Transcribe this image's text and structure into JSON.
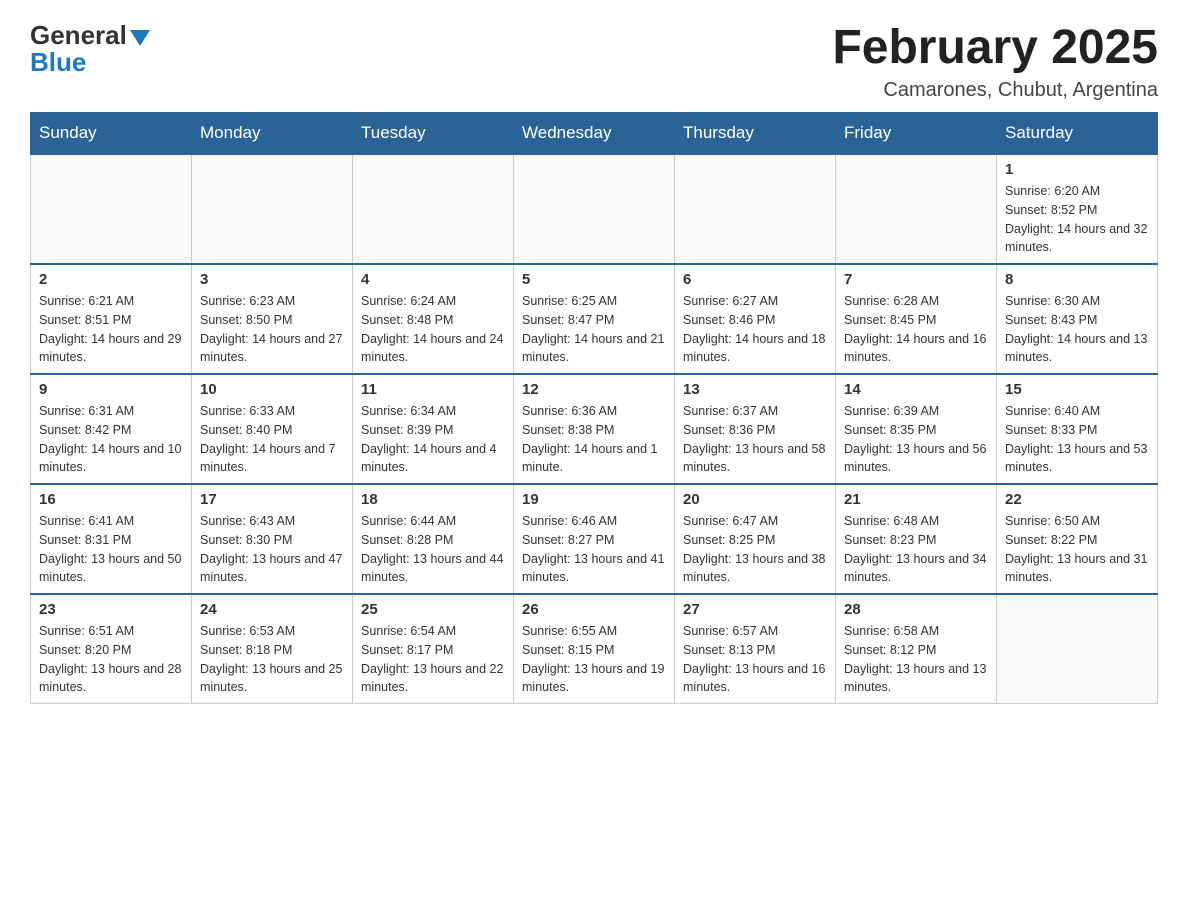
{
  "logo": {
    "text_general": "General",
    "text_blue": "Blue"
  },
  "header": {
    "month_title": "February 2025",
    "location": "Camarones, Chubut, Argentina"
  },
  "days_of_week": [
    "Sunday",
    "Monday",
    "Tuesday",
    "Wednesday",
    "Thursday",
    "Friday",
    "Saturday"
  ],
  "weeks": [
    [
      {
        "day": "",
        "info": ""
      },
      {
        "day": "",
        "info": ""
      },
      {
        "day": "",
        "info": ""
      },
      {
        "day": "",
        "info": ""
      },
      {
        "day": "",
        "info": ""
      },
      {
        "day": "",
        "info": ""
      },
      {
        "day": "1",
        "info": "Sunrise: 6:20 AM\nSunset: 8:52 PM\nDaylight: 14 hours and 32 minutes."
      }
    ],
    [
      {
        "day": "2",
        "info": "Sunrise: 6:21 AM\nSunset: 8:51 PM\nDaylight: 14 hours and 29 minutes."
      },
      {
        "day": "3",
        "info": "Sunrise: 6:23 AM\nSunset: 8:50 PM\nDaylight: 14 hours and 27 minutes."
      },
      {
        "day": "4",
        "info": "Sunrise: 6:24 AM\nSunset: 8:48 PM\nDaylight: 14 hours and 24 minutes."
      },
      {
        "day": "5",
        "info": "Sunrise: 6:25 AM\nSunset: 8:47 PM\nDaylight: 14 hours and 21 minutes."
      },
      {
        "day": "6",
        "info": "Sunrise: 6:27 AM\nSunset: 8:46 PM\nDaylight: 14 hours and 18 minutes."
      },
      {
        "day": "7",
        "info": "Sunrise: 6:28 AM\nSunset: 8:45 PM\nDaylight: 14 hours and 16 minutes."
      },
      {
        "day": "8",
        "info": "Sunrise: 6:30 AM\nSunset: 8:43 PM\nDaylight: 14 hours and 13 minutes."
      }
    ],
    [
      {
        "day": "9",
        "info": "Sunrise: 6:31 AM\nSunset: 8:42 PM\nDaylight: 14 hours and 10 minutes."
      },
      {
        "day": "10",
        "info": "Sunrise: 6:33 AM\nSunset: 8:40 PM\nDaylight: 14 hours and 7 minutes."
      },
      {
        "day": "11",
        "info": "Sunrise: 6:34 AM\nSunset: 8:39 PM\nDaylight: 14 hours and 4 minutes."
      },
      {
        "day": "12",
        "info": "Sunrise: 6:36 AM\nSunset: 8:38 PM\nDaylight: 14 hours and 1 minute."
      },
      {
        "day": "13",
        "info": "Sunrise: 6:37 AM\nSunset: 8:36 PM\nDaylight: 13 hours and 58 minutes."
      },
      {
        "day": "14",
        "info": "Sunrise: 6:39 AM\nSunset: 8:35 PM\nDaylight: 13 hours and 56 minutes."
      },
      {
        "day": "15",
        "info": "Sunrise: 6:40 AM\nSunset: 8:33 PM\nDaylight: 13 hours and 53 minutes."
      }
    ],
    [
      {
        "day": "16",
        "info": "Sunrise: 6:41 AM\nSunset: 8:31 PM\nDaylight: 13 hours and 50 minutes."
      },
      {
        "day": "17",
        "info": "Sunrise: 6:43 AM\nSunset: 8:30 PM\nDaylight: 13 hours and 47 minutes."
      },
      {
        "day": "18",
        "info": "Sunrise: 6:44 AM\nSunset: 8:28 PM\nDaylight: 13 hours and 44 minutes."
      },
      {
        "day": "19",
        "info": "Sunrise: 6:46 AM\nSunset: 8:27 PM\nDaylight: 13 hours and 41 minutes."
      },
      {
        "day": "20",
        "info": "Sunrise: 6:47 AM\nSunset: 8:25 PM\nDaylight: 13 hours and 38 minutes."
      },
      {
        "day": "21",
        "info": "Sunrise: 6:48 AM\nSunset: 8:23 PM\nDaylight: 13 hours and 34 minutes."
      },
      {
        "day": "22",
        "info": "Sunrise: 6:50 AM\nSunset: 8:22 PM\nDaylight: 13 hours and 31 minutes."
      }
    ],
    [
      {
        "day": "23",
        "info": "Sunrise: 6:51 AM\nSunset: 8:20 PM\nDaylight: 13 hours and 28 minutes."
      },
      {
        "day": "24",
        "info": "Sunrise: 6:53 AM\nSunset: 8:18 PM\nDaylight: 13 hours and 25 minutes."
      },
      {
        "day": "25",
        "info": "Sunrise: 6:54 AM\nSunset: 8:17 PM\nDaylight: 13 hours and 22 minutes."
      },
      {
        "day": "26",
        "info": "Sunrise: 6:55 AM\nSunset: 8:15 PM\nDaylight: 13 hours and 19 minutes."
      },
      {
        "day": "27",
        "info": "Sunrise: 6:57 AM\nSunset: 8:13 PM\nDaylight: 13 hours and 16 minutes."
      },
      {
        "day": "28",
        "info": "Sunrise: 6:58 AM\nSunset: 8:12 PM\nDaylight: 13 hours and 13 minutes."
      },
      {
        "day": "",
        "info": ""
      }
    ]
  ]
}
